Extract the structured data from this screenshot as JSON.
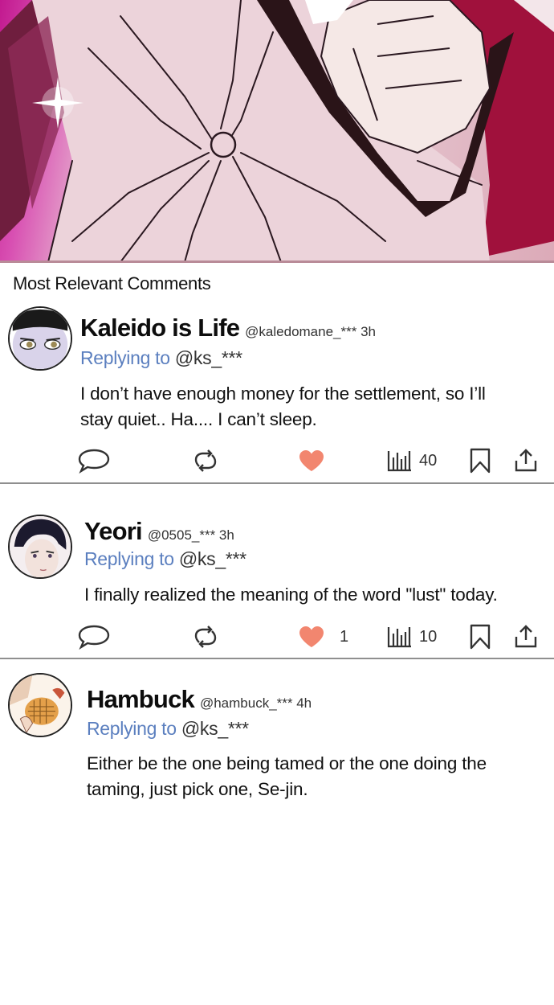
{
  "section": {
    "title": "Most Relevant Comments"
  },
  "colors": {
    "reply_blue": "#5b7fbf",
    "heart": "#f2866f",
    "divider": "#8f8f8f"
  },
  "icons": {
    "comment": "speech-bubble-icon",
    "retweet": "retweet-icon",
    "like": "heart-icon",
    "stats": "bar-chart-icon",
    "bookmark": "bookmark-icon",
    "share": "share-icon"
  },
  "comments": [
    {
      "name": "Kaleido is Life",
      "handle_time": "@kaledomane_*** 3h",
      "reply_prefix": "Replying to",
      "reply_target": "@ks_***",
      "text": "I don’t have enough money for the settlement, so I’ll stay quiet.. Ha.... I can’t sleep.",
      "likes": "",
      "views": "40"
    },
    {
      "name": "Yeori",
      "handle_time": "@0505_*** 3h",
      "reply_prefix": "Replying to",
      "reply_target": "@ks_***",
      "text": "I finally realized the meaning of the word \"lust\" today.",
      "likes": "1",
      "views": "10"
    },
    {
      "name": "Hambuck",
      "handle_time": "@hambuck_*** 4h",
      "reply_prefix": "Replying to",
      "reply_target": "@ks_***",
      "text": "Either be the one being tamed or the one doing the taming, just pick one, Se-jin."
    }
  ]
}
